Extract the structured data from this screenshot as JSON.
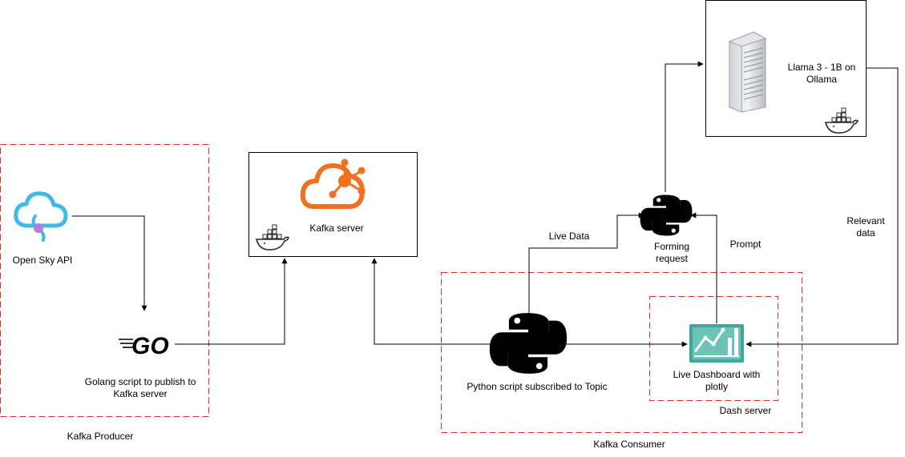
{
  "groups": {
    "producer": "Kafka Producer",
    "consumer": "Kafka Consumer",
    "dash": "Dash server"
  },
  "nodes": {
    "open_sky": "Open Sky API",
    "golang": "Golang script to publish to\nKafka server",
    "kafka": "Kafka server",
    "python_sub": "Python script subscribed to Topic",
    "forming": "Forming\nrequest",
    "dashboard": "Live Dashboard with\nplotly",
    "llama": "Llama 3 - 1B on\nOllama"
  },
  "edges": {
    "live_data": "Live Data",
    "prompt": "Prompt",
    "relevant": "Relevant\ndata"
  },
  "logo_text": {
    "go": "GO"
  },
  "colors": {
    "group_dash": "#cc3333",
    "kafka_orange": "#f26f21",
    "cloud_blue": "#41b8e6",
    "dash_teal": "#3fa89a",
    "line": "#000000"
  }
}
